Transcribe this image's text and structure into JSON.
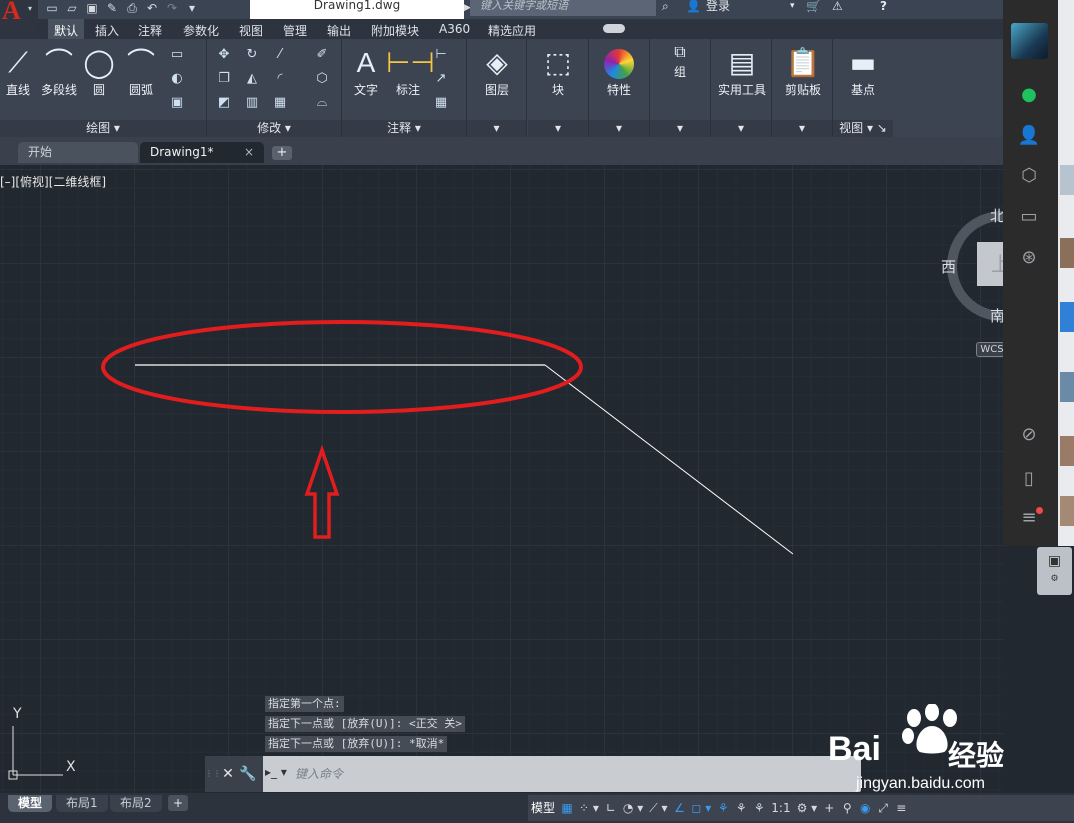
{
  "titlebar": {
    "document_title": "Drawing1.dwg",
    "search_placeholder": "键入关键字或短语",
    "login_label": "登录",
    "help_label": "?"
  },
  "ribbon_tabs": [
    "默认",
    "插入",
    "注释",
    "参数化",
    "视图",
    "管理",
    "输出",
    "附加模块",
    "A360",
    "精选应用"
  ],
  "ribbon": {
    "draw": {
      "label": "绘图",
      "tools": [
        "直线",
        "多段线",
        "圆",
        "圆弧"
      ]
    },
    "modify": {
      "label": "修改"
    },
    "annotation": {
      "label": "注释",
      "tools": [
        "文字",
        "标注"
      ]
    },
    "layers": {
      "label": "图层"
    },
    "block": {
      "label": "块"
    },
    "properties": {
      "label": "特性"
    },
    "groups": {
      "label": "组"
    },
    "utilities": {
      "label": "实用工具"
    },
    "clipboard": {
      "label": "剪贴板"
    },
    "view": {
      "tool": "基点",
      "label": "视图"
    }
  },
  "file_tabs": {
    "start": "开始",
    "drawing": "Drawing1*",
    "close": "×",
    "add": "+"
  },
  "viewport_label": "[–][俯视][二维线框]",
  "viewcube": {
    "north": "北",
    "west": "西",
    "south": "南",
    "face": "上",
    "wcs": "WCS"
  },
  "command_history": [
    "指定第一个点:",
    "指定下一点或 [放弃(U)]:  <正交 关>",
    "指定下一点或 [放弃(U)]: *取消*"
  ],
  "command_bar": {
    "placeholder": "键入命令"
  },
  "ucs": {
    "x": "X",
    "y": "Y"
  },
  "layout_tabs": [
    "模型",
    "布局1",
    "布局2"
  ],
  "status_bar": {
    "model": "模型",
    "scale": "1:1"
  },
  "watermark": {
    "brand": "Bai",
    "brand_cn": "经验",
    "url": "jingyan.baidu.com"
  },
  "colors": {
    "accent_red": "#d52b1e",
    "annotation_red": "#e11d1d",
    "canvas": "#212830",
    "ribbon": "#3c4452"
  }
}
